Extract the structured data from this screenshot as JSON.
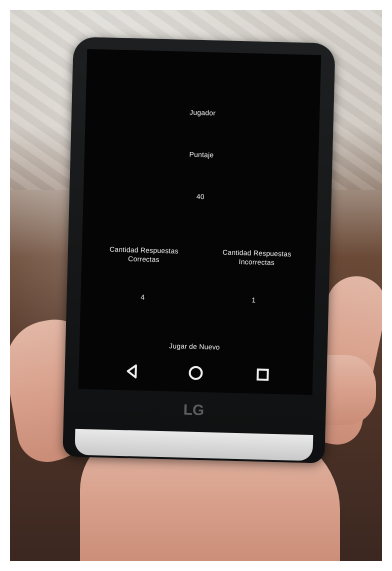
{
  "screen": {
    "player_label": "Jugador",
    "score_label": "Puntaje",
    "score_value": "40",
    "correct_label": "Cantidad Respuestas Correctas",
    "incorrect_label": "Cantidad Respuestas Incorrectas",
    "correct_value": "4",
    "incorrect_value": "1",
    "play_again_label": "Jugar de Nuevo"
  },
  "device": {
    "brand": "LG"
  },
  "nav_icons": [
    "back-icon",
    "home-icon",
    "recent-apps-icon"
  ]
}
